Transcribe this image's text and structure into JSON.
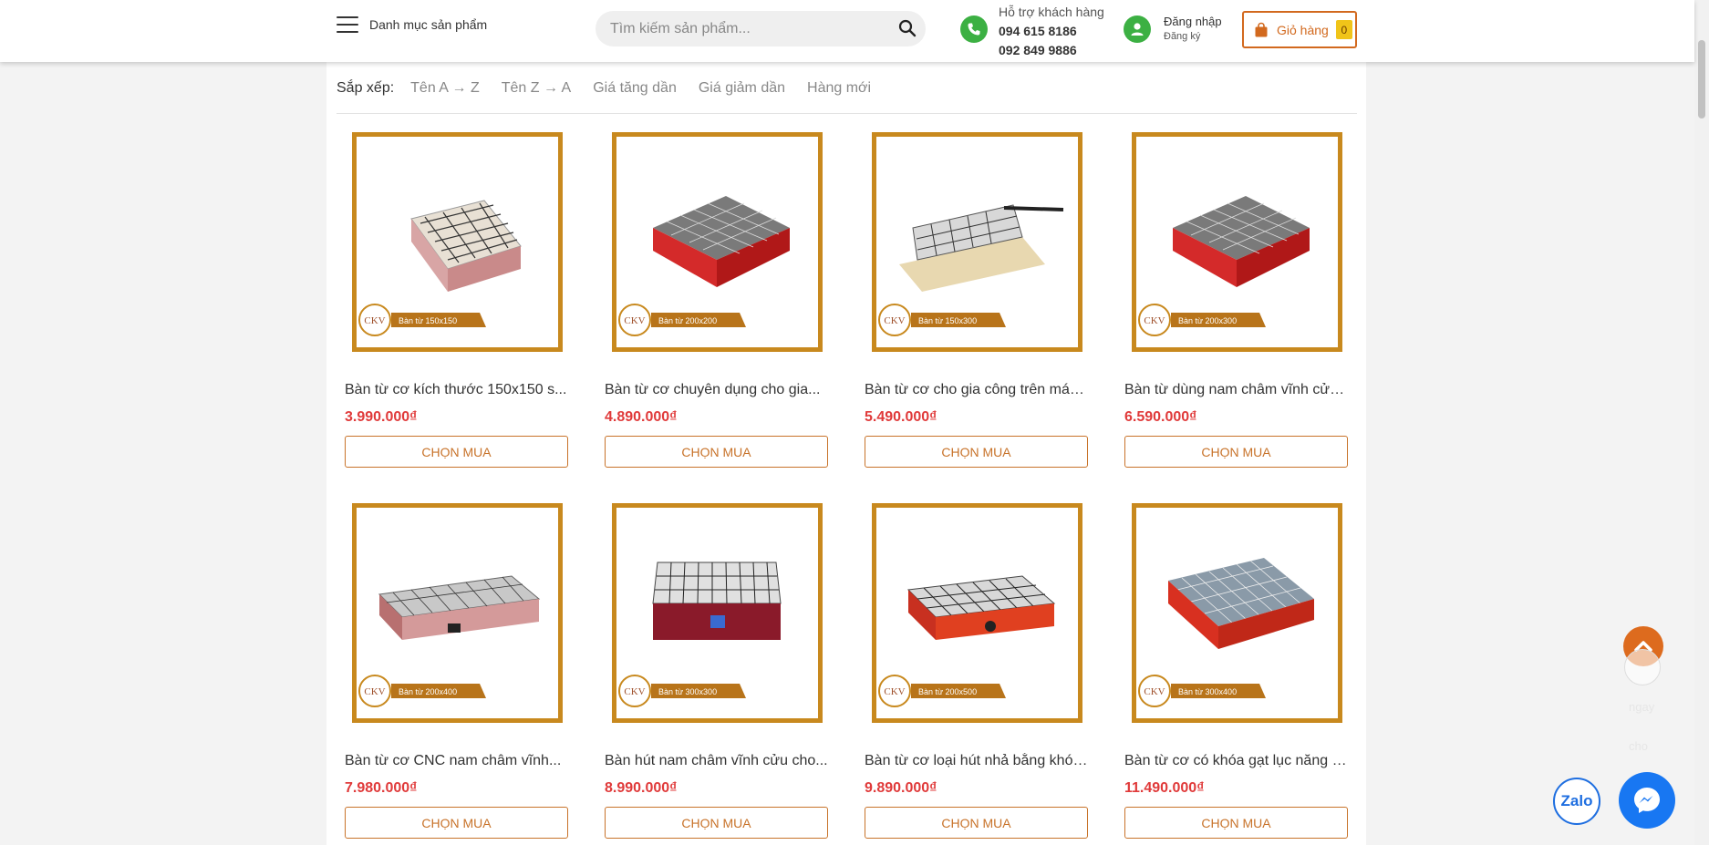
{
  "header": {
    "menu_label": "Danh mục sản phẩm",
    "search_placeholder": "Tìm kiếm sản phẩm...",
    "support_title": "Hỗ trợ khách hàng",
    "phones": [
      "094 615 8186",
      "092 849 9886"
    ],
    "login_label": "Đăng nhập",
    "register_label": "Đăng ký",
    "cart_label": "Giỏ hàng",
    "cart_count": "0"
  },
  "sort": {
    "label": "Sắp xếp:",
    "options": [
      "Tên A → Z",
      "Tên Z → A",
      "Giá tăng dần",
      "Giá giảm dần",
      "Hàng mới"
    ]
  },
  "products": [
    {
      "name": "Bàn từ cơ kích thước 150x150 s...",
      "price": "3.990.000₫",
      "button": "CHỌN MUA",
      "badge": "Bàn từ 150x150",
      "logo": "CKV"
    },
    {
      "name": "Bàn từ cơ chuyên dụng cho gia...",
      "price": "4.890.000₫",
      "button": "CHỌN MUA",
      "badge": "Bàn từ 200x200",
      "logo": "CKV"
    },
    {
      "name": "Bàn từ cơ cho gia công trên máy...",
      "price": "5.490.000₫",
      "button": "CHỌN MUA",
      "badge": "Bàn từ 150x300",
      "logo": "CKV"
    },
    {
      "name": "Bàn từ dùng nam châm vĩnh cửu...",
      "price": "6.590.000₫",
      "button": "CHỌN MUA",
      "badge": "Bàn từ 200x300",
      "logo": "CKV"
    },
    {
      "name": "Bàn từ cơ CNC nam châm vĩnh...",
      "price": "7.980.000₫",
      "button": "CHỌN MUA",
      "badge": "Bàn từ 200x400",
      "logo": "CKV"
    },
    {
      "name": "Bàn hút nam châm vĩnh cửu cho...",
      "price": "8.990.000₫",
      "button": "CHỌN MUA",
      "badge": "Bàn từ 300x300",
      "logo": "CKV"
    },
    {
      "name": "Bàn từ cơ loại hút nhả bằng khóa...",
      "price": "9.890.000₫",
      "button": "CHỌN MUA",
      "badge": "Bàn từ 200x500",
      "logo": "CKV"
    },
    {
      "name": "Bàn từ cơ có khóa gạt lục năng đ...",
      "price": "11.490.000₫",
      "button": "CHỌN MUA",
      "badge": "Bàn từ 300x400",
      "logo": "CKV"
    }
  ],
  "floating": {
    "zalo_label": "Zalo",
    "side_texts": [
      "ngay",
      "cho"
    ]
  },
  "colors": {
    "accent": "#d2691e",
    "frame": "#c8891e",
    "price": "#e03a3a",
    "support_green": "#3cb043",
    "messenger_blue": "#1877f2"
  }
}
